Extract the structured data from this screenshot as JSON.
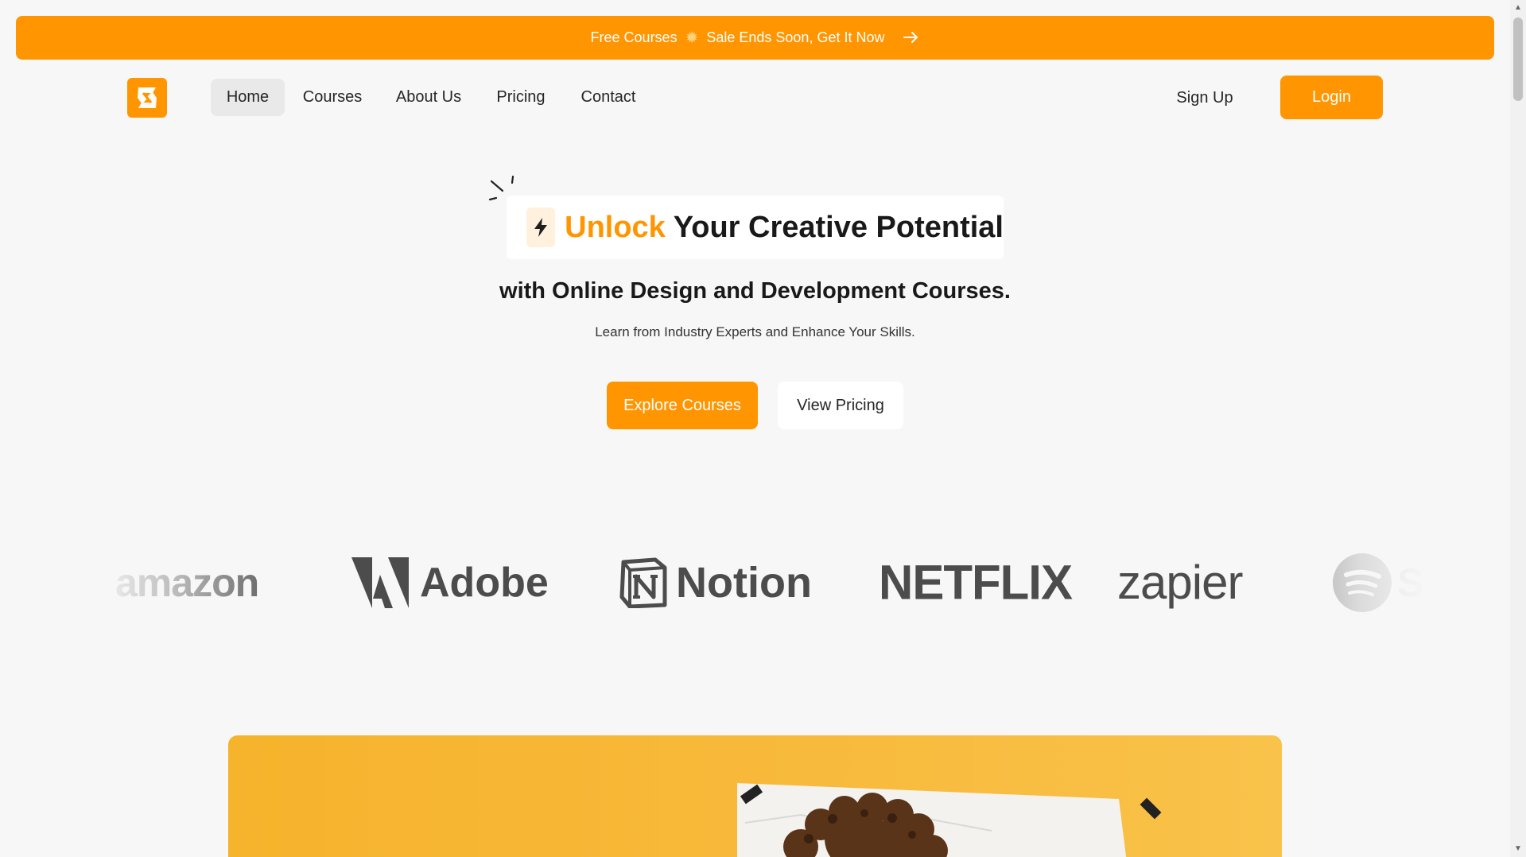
{
  "promo": {
    "text_left": "Free Courses",
    "text_right": "Sale Ends Soon, Get It Now",
    "sun_icon": "sun-icon",
    "arrow_icon": "arrow-right-icon"
  },
  "brand": {
    "logo_icon": "brand-logo-icon",
    "accent_color": "#ff9500"
  },
  "nav": {
    "home": "Home",
    "courses": "Courses",
    "about": "About Us",
    "pricing": "Pricing",
    "contact": "Contact",
    "active": "Home"
  },
  "auth": {
    "signup": "Sign Up",
    "login": "Login"
  },
  "hero": {
    "headline_accent": "Unlock",
    "headline_rest": "Your Creative Potential",
    "subheadline": "with Online Design and Development Courses.",
    "tagline": "Learn from Industry Experts and Enhance Your Skills.",
    "explore_button": "Explore Courses",
    "pricing_button": "View Pricing",
    "bolt_icon": "lightning-bolt-icon"
  },
  "partners": {
    "amazon": "amazon",
    "adobe": "Adobe",
    "notion": "Notion",
    "netflix": "NETFLIX",
    "zapier": "zapier",
    "spotify_partial": "S"
  }
}
